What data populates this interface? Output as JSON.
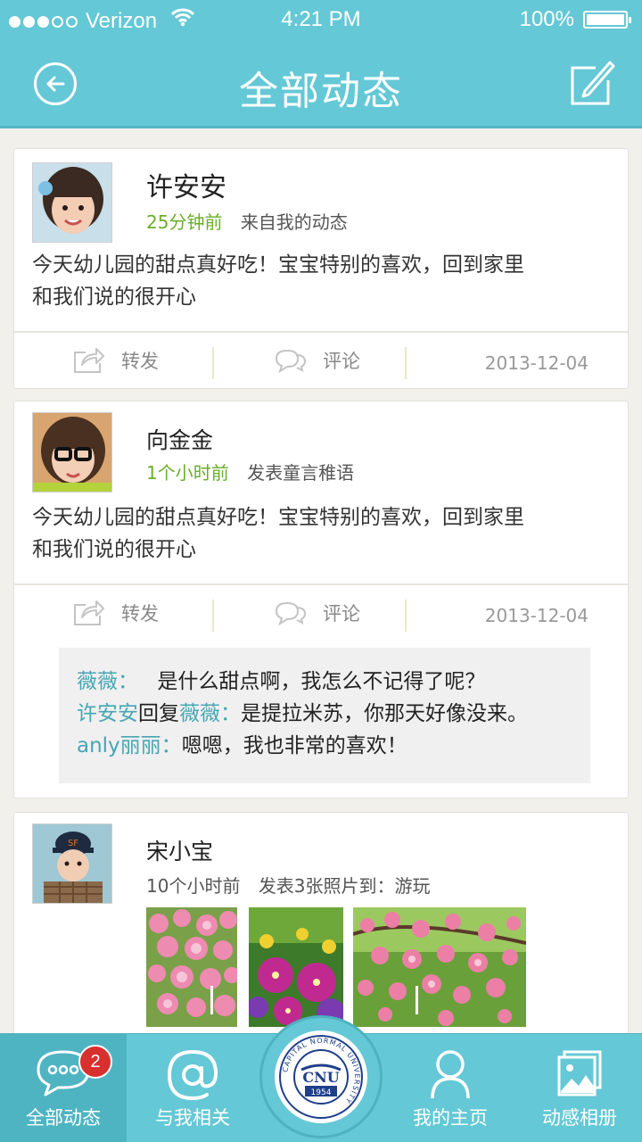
{
  "status_bar": {
    "carrier": "Verizon",
    "time": "4:21 PM",
    "battery": "100%"
  },
  "header": {
    "title": "全部动态"
  },
  "posts": [
    {
      "name": "许安安",
      "time_ago": "25分钟前",
      "source": "来自我的动态",
      "text_line1": "今天幼儿园的甜点真好吃！宝宝特别的喜欢，回到家里",
      "text_line2": "和我们说的很开心",
      "forward_label": "转发",
      "comment_label": "评论",
      "date": "2013-12-04"
    },
    {
      "name": "向金金",
      "time_ago": "1个小时前",
      "source": "发表童言稚语",
      "text_line1": "今天幼儿园的甜点真好吃！宝宝特别的喜欢，回到家里",
      "text_line2": "和我们说的很开心",
      "forward_label": "转发",
      "comment_label": "评论",
      "date": "2013-12-04",
      "comments": [
        {
          "user": "薇薇：",
          "text": "是什么甜点啊，我怎么不记得了呢？"
        },
        {
          "user": "许安安",
          "reply_word": "回复",
          "reply_to": "薇薇：",
          "text": "是提拉米苏，你那天好像没来。"
        },
        {
          "user": "anly丽丽：",
          "text": "嗯嗯，我也非常的喜欢！"
        }
      ]
    },
    {
      "name": "宋小宝",
      "time_ago": "10个小时前",
      "source": "发表3张照片到：游玩"
    }
  ],
  "tabs": [
    {
      "label": "全部动态",
      "icon": "chat-bubble-icon",
      "badge": "2"
    },
    {
      "label": "与我相关",
      "icon": "at-sign-icon"
    },
    {
      "label": "我的主页",
      "icon": "person-icon"
    },
    {
      "label": "动感相册",
      "icon": "photo-album-icon"
    }
  ],
  "logo": {
    "text": "CNU",
    "year": "1954",
    "ring_text": "CAPITAL NORMAL UNIVERSITY"
  },
  "colors": {
    "primary": "#64c8d6",
    "time_green": "#6aae2a",
    "comment_user": "#47a6b3",
    "badge_red": "#d82f2f"
  }
}
